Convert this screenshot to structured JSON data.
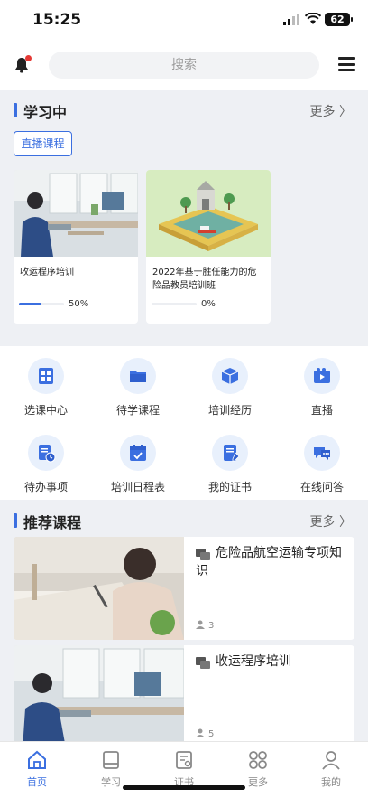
{
  "status_bar": {
    "time": "15:25",
    "battery": "62"
  },
  "top_bar": {
    "search_placeholder": "搜索"
  },
  "learning": {
    "title": "学习中",
    "more": "更多 〉",
    "live_button": "直播课程",
    "courses": [
      {
        "name": "收运程序培训",
        "progress": 0.5,
        "progress_label": "50%"
      },
      {
        "name": "2022年基于胜任能力的危险品教员培训班",
        "progress": 0,
        "progress_label": "0%"
      }
    ]
  },
  "shortcuts": [
    {
      "label": "选课中心",
      "icon": "course-select-icon"
    },
    {
      "label": "待学课程",
      "icon": "folder-icon"
    },
    {
      "label": "培训经历",
      "icon": "book-box-icon"
    },
    {
      "label": "直播",
      "icon": "live-video-icon"
    },
    {
      "label": "待办事项",
      "icon": "todo-clock-icon"
    },
    {
      "label": "培训日程表",
      "icon": "calendar-icon"
    },
    {
      "label": "我的证书",
      "icon": "certificate-icon"
    },
    {
      "label": "在线问答",
      "icon": "chat-bubbles-icon"
    }
  ],
  "recommended": {
    "title": "推荐课程",
    "more": "更多 〉",
    "courses": [
      {
        "title": "危险品航空运输专项知识",
        "learners": "3"
      },
      {
        "title": "收运程序培训",
        "learners": "5"
      }
    ]
  },
  "tab_bar": [
    {
      "label": "首页",
      "icon": "home-icon",
      "active": true
    },
    {
      "label": "学习",
      "icon": "book-icon",
      "active": false
    },
    {
      "label": "证书",
      "icon": "certificate-icon",
      "active": false
    },
    {
      "label": "更多",
      "icon": "grid-icon",
      "active": false
    },
    {
      "label": "我的",
      "icon": "user-icon",
      "active": false
    }
  ],
  "colors": {
    "accent": "#3b6fe0",
    "background": "#eef0f4",
    "notification_dot": "#e53935"
  }
}
